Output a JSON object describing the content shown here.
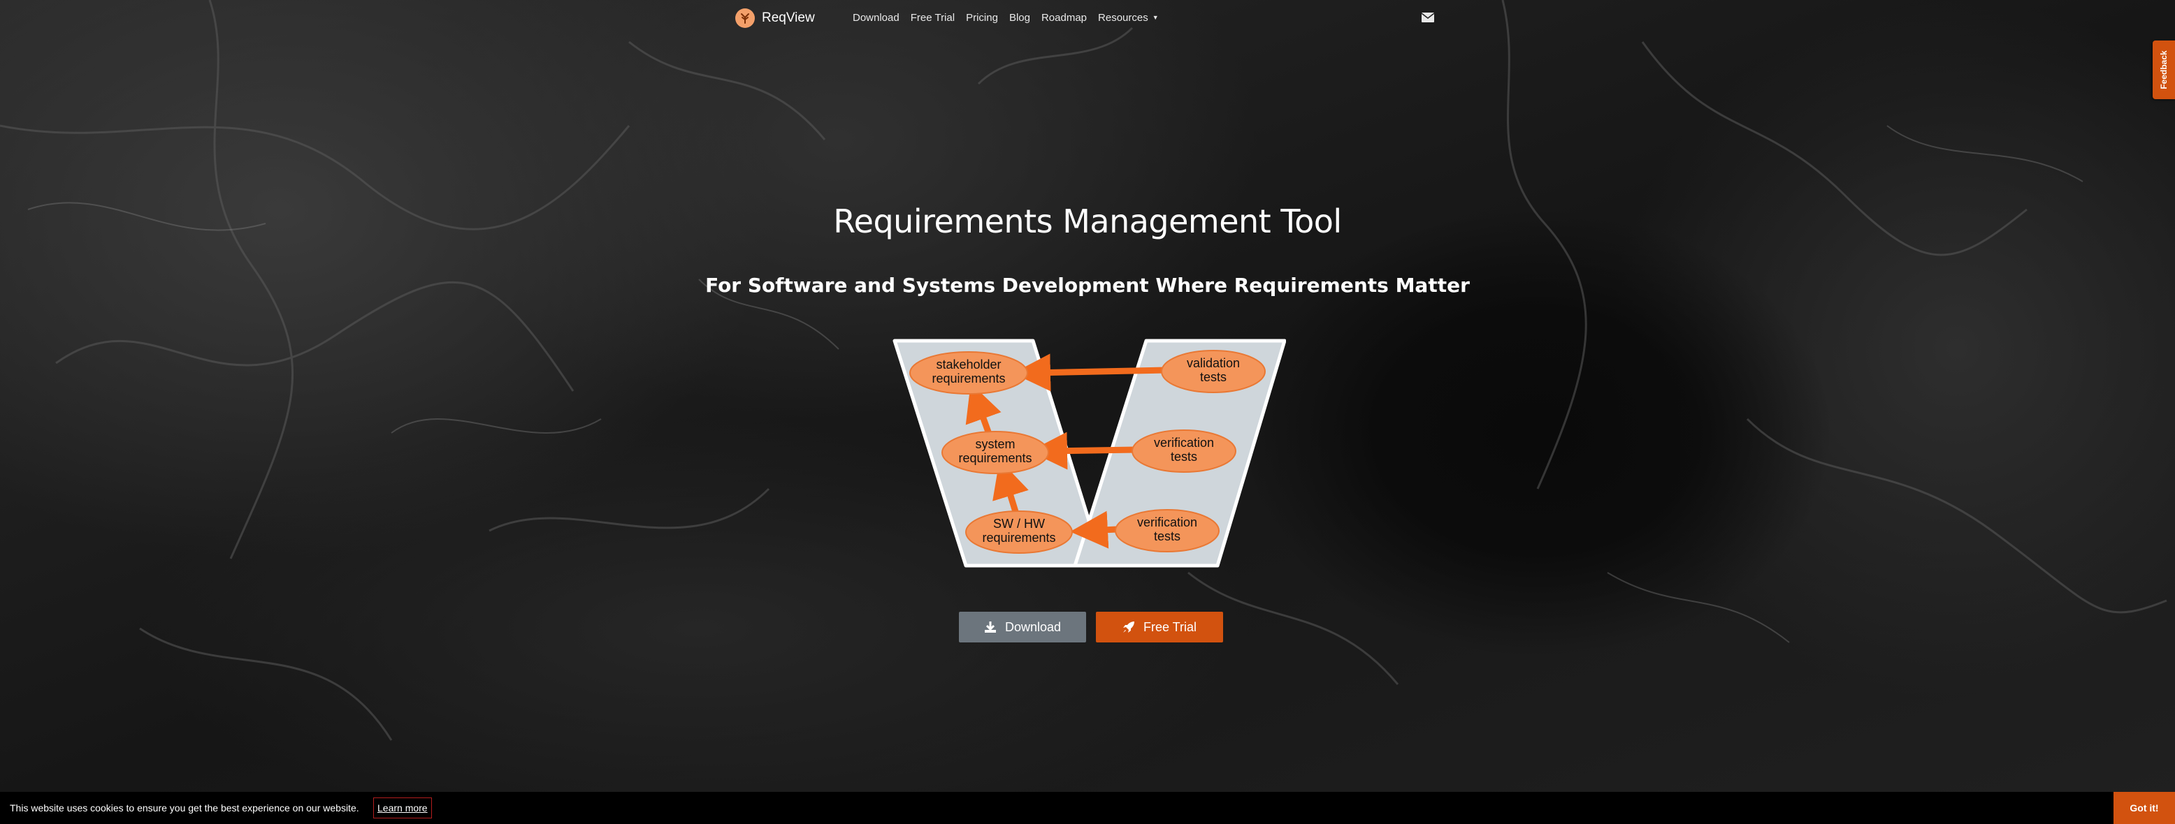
{
  "brand": {
    "name": "ReqView"
  },
  "nav": {
    "items": [
      "Download",
      "Free Trial",
      "Pricing",
      "Blog",
      "Roadmap"
    ],
    "resources_label": "Resources"
  },
  "feedback": {
    "label": "Feedback"
  },
  "hero": {
    "title": "Requirements Management Tool",
    "subtitle": "For Software and Systems Development Where Requirements Matter"
  },
  "vmodel": {
    "left": [
      {
        "line1": "stakeholder",
        "line2": "requirements"
      },
      {
        "line1": "system",
        "line2": "requirements"
      },
      {
        "line1": "SW / HW",
        "line2": "requirements"
      }
    ],
    "right": [
      {
        "line1": "validation",
        "line2": "tests"
      },
      {
        "line1": "verification",
        "line2": "tests"
      },
      {
        "line1": "verification",
        "line2": "tests"
      }
    ]
  },
  "buttons": {
    "download": "Download",
    "free_trial": "Free Trial"
  },
  "cookie": {
    "text": "This website uses cookies to ensure you get the best experience on our website.",
    "learn_more": "Learn more",
    "accept": "Got it!"
  },
  "colors": {
    "accent": "#d2520f",
    "ellipse_fill": "#f4955a",
    "ellipse_stroke": "#e97834",
    "arrow": "#f26b1d",
    "panel": "#cfd6db",
    "download_button": "#6c757d"
  }
}
